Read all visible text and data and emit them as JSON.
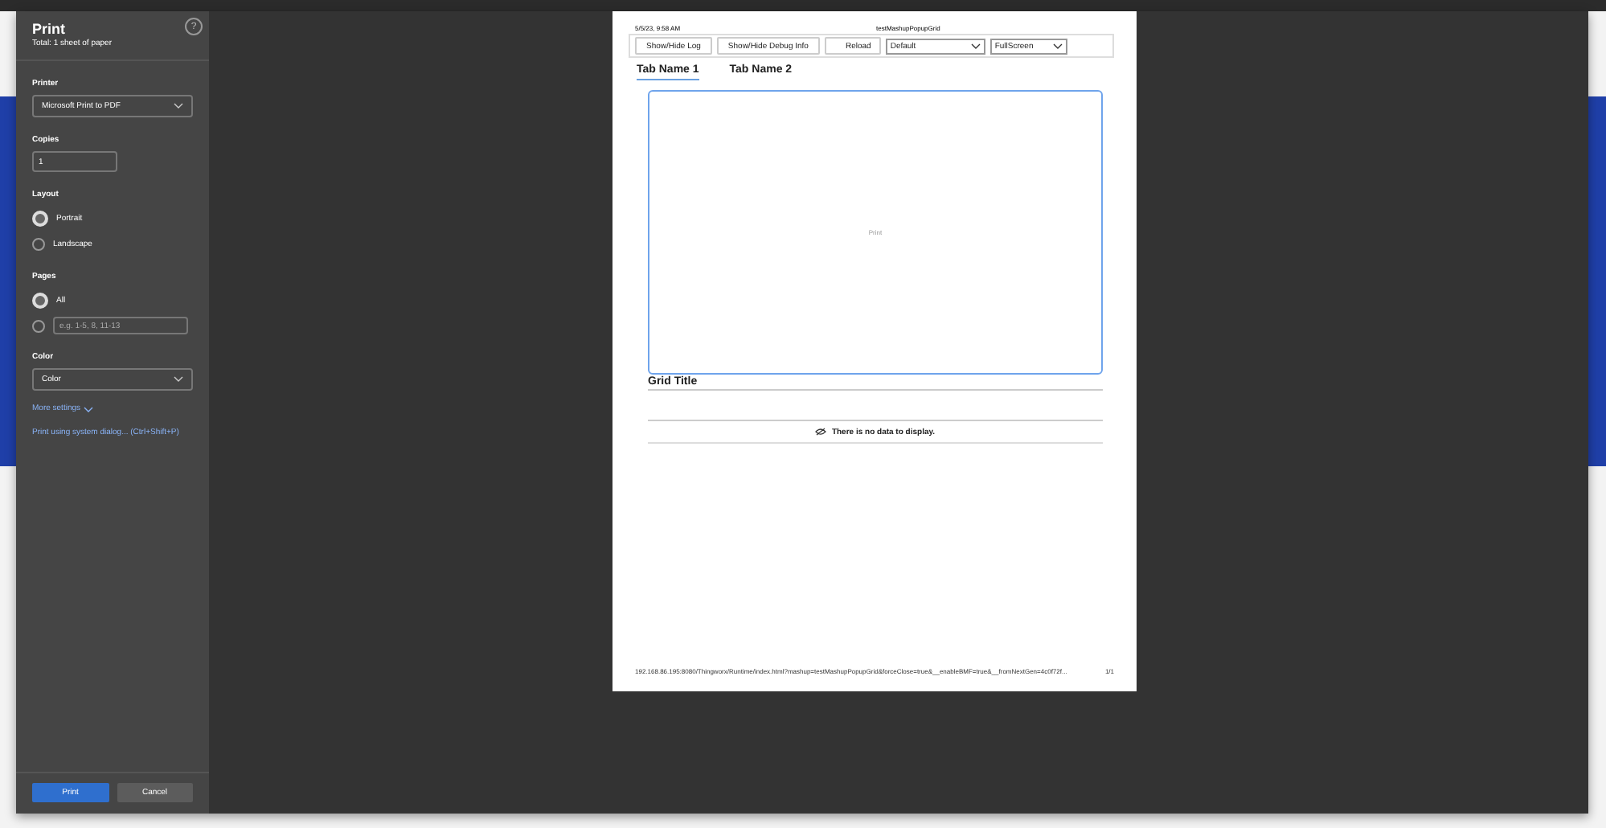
{
  "dialog": {
    "title": "Print",
    "summary": "Total: 1 sheet of paper",
    "help": "?"
  },
  "printer": {
    "label": "Printer",
    "value": "Microsoft Print to PDF"
  },
  "copies": {
    "label": "Copies",
    "value": "1"
  },
  "layout": {
    "label": "Layout",
    "options": [
      {
        "label": "Portrait",
        "selected": true
      },
      {
        "label": "Landscape",
        "selected": false
      }
    ]
  },
  "pages": {
    "label": "Pages",
    "options": [
      {
        "kind": "label",
        "label": "All",
        "selected": true
      },
      {
        "kind": "field",
        "placeholder": "e.g. 1-5, 8, 11-13",
        "selected": false
      }
    ]
  },
  "color": {
    "label": "Color",
    "value": "Color"
  },
  "more_settings": "More settings",
  "system_dialog": "Print using system dialog... (Ctrl+Shift+P)",
  "buttons": [
    {
      "label": "Print",
      "kind": "primary"
    },
    {
      "label": "Cancel",
      "kind": "secondary"
    }
  ],
  "preview": {
    "header_date": "5/5/23, 9:58 AM",
    "header_title": "testMashupPopupGrid",
    "toolbar": [
      {
        "kind": "button",
        "label": "Show/Hide Log"
      },
      {
        "kind": "button",
        "label": "Show/Hide Debug Info"
      },
      {
        "kind": "button",
        "label": "Reload"
      },
      {
        "kind": "select",
        "label": "Default"
      },
      {
        "kind": "select",
        "label": "FullScreen"
      }
    ],
    "tabs": [
      {
        "label": "Tab Name 1",
        "selected": true
      },
      {
        "label": "Tab Name 2",
        "selected": false
      }
    ],
    "panel_text": "Print",
    "grid_title": "Grid Title",
    "empty_message": "There is no data to display.",
    "footer_url": "192.168.86.195:8080/Thingworx/Runtime/index.html?mashup=testMashupPopupGrid&forceClose=true&__enableBMF=true&__fromNextGen=4c0f72f...",
    "page_number": "1/1"
  }
}
